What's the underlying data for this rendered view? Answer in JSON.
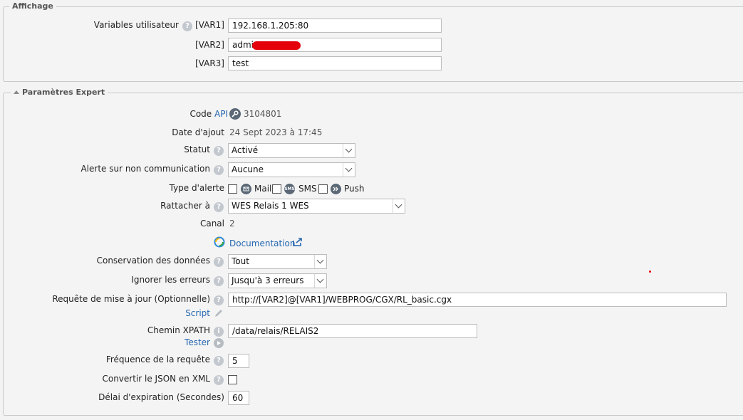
{
  "affichage": {
    "legend": "Affichage",
    "user_vars_label": "Variables utilisateur",
    "var1_tag": "[VAR1]",
    "var1_value": "192.168.1.205:80",
    "var2_tag": "[VAR2]",
    "var2_value": "admin",
    "var3_tag": "[VAR3]",
    "var3_value": "test"
  },
  "expert": {
    "legend": "Paramètres Expert",
    "code_label": "Code",
    "code_api_link": "API",
    "code_value": "3104801",
    "date_label": "Date d'ajout",
    "date_value": "24 Sept 2023 à 17:45",
    "statut_label": "Statut",
    "statut_value": "Activé",
    "alerte_label": "Alerte sur non communication",
    "alerte_value": "Aucune",
    "type_alerte_label": "Type d'alerte",
    "alert_mail": "Mail",
    "alert_sms": "SMS",
    "alert_sms_icon_text": "SMS",
    "alert_push": "Push",
    "rattacher_label": "Rattacher à",
    "rattacher_value": "WES Relais 1 WES",
    "canal_label": "Canal",
    "canal_value": "2",
    "documentation_link": "Documentation",
    "conservation_label": "Conservation des données",
    "conservation_value": "Tout",
    "ignorer_label": "Ignorer les erreurs",
    "ignorer_value": "Jusqu'à 3 erreurs",
    "requete_label": "Requête de mise à jour (Optionnelle)",
    "requete_value": "http://[VAR2]@[VAR1]/WEBPROG/CGX/RL_basic.cgx",
    "script_link": "Script",
    "xpath_label": "Chemin XPATH",
    "xpath_value": "/data/relais/RELAIS2",
    "tester_link": "Tester",
    "frequence_label": "Fréquence de la requête",
    "frequence_value": "5",
    "convertir_label": "Convertir le JSON en XML",
    "delai_label": "Délai d'expiration (Secondes)",
    "delai_value": "60"
  },
  "icons": {
    "help_glyph": "?",
    "info_glyph": "i"
  },
  "colors": {
    "link": "#2466b0",
    "redaction": "#e3000b",
    "icon_grey": "#c3c8cf"
  }
}
